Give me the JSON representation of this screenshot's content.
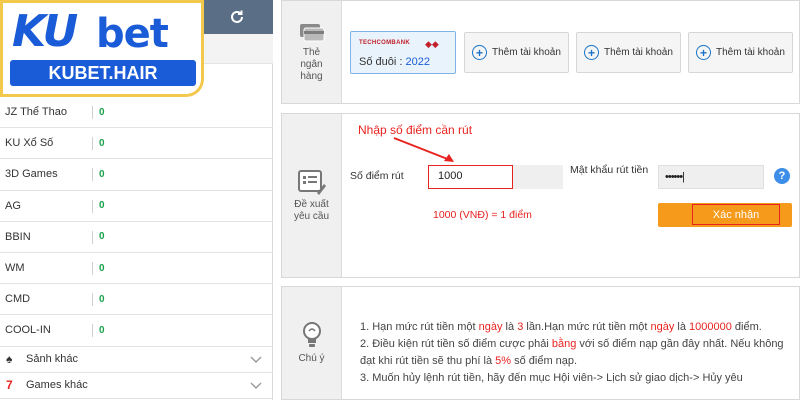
{
  "logo": {
    "ku": "KU",
    "bet": "bet",
    "domain": "KUBET.HAIR"
  },
  "sidebar": {
    "games": [
      {
        "name": "JZ Thể Thao",
        "value": "0"
      },
      {
        "name": "KU Xổ Số",
        "value": "0"
      },
      {
        "name": "3D Games",
        "value": "0"
      },
      {
        "name": "AG",
        "value": "0"
      },
      {
        "name": "BBIN",
        "value": "0"
      },
      {
        "name": "WM",
        "value": "0"
      },
      {
        "name": "CMD",
        "value": "0"
      },
      {
        "name": "COOL-IN",
        "value": "0"
      }
    ],
    "groups": [
      {
        "label": "Sảnh khác",
        "icon": "spade-icon"
      },
      {
        "label": "Games khác",
        "icon": "seven-icon"
      }
    ]
  },
  "bank_panel": {
    "label": "Thẻ ngân hàng",
    "card": {
      "brand": "TECHCOMBANK",
      "suffix_label": "Số đuôi :",
      "suffix_value": "2022"
    },
    "add_buttons": [
      "Thêm tài khoản",
      "Thêm tài khoản",
      "Thêm tài khoản"
    ]
  },
  "withdraw_panel": {
    "label": "Đề xuất yêu cầu",
    "hint": "Nhập số điểm cần rút",
    "amount_label": "Số điểm rút",
    "amount_value": "1000",
    "password_label": "Mật khẩu rút tiền",
    "password_value": "••••••|",
    "rate": "1000 (VNĐ) = 1 điểm",
    "confirm": "Xác nhận",
    "help": "?"
  },
  "notes_panel": {
    "label": "Chú ý",
    "notes": [
      {
        "parts": [
          {
            "t": "1.  Hạn mức rút tiền một "
          },
          {
            "t": "ngày",
            "hl": true
          },
          {
            "t": " là "
          },
          {
            "t": "3",
            "hl": true
          },
          {
            "t": " lần.Hạn mức rút tiền một "
          },
          {
            "t": "ngày",
            "hl": true
          },
          {
            "t": " là "
          },
          {
            "t": "1000000",
            "hl": true
          },
          {
            "t": " điểm."
          }
        ]
      },
      {
        "parts": [
          {
            "t": "2.  Điều kiện rút tiền số điểm cược phải "
          },
          {
            "t": "bằng",
            "hl": true
          },
          {
            "t": " với số điểm nạp gần đây nhất. Nếu không đạt khi rút tiền sẽ thu phí là "
          },
          {
            "t": "5%",
            "hl": true
          },
          {
            "t": " số điểm nạp."
          }
        ]
      },
      {
        "parts": [
          {
            "t": "3.  Muốn hủy lệnh rút tiền, hãy đến mục Hội viên-> Lịch sử giao dịch-> Hủy yêu"
          }
        ]
      }
    ]
  }
}
